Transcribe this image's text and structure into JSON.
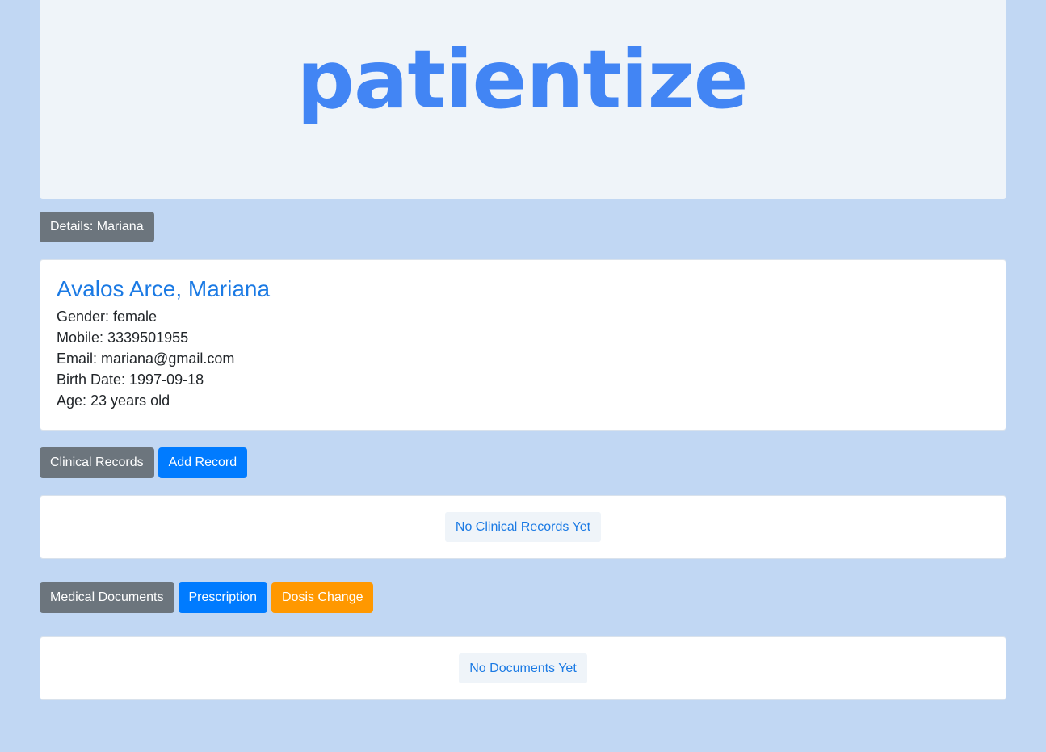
{
  "brand": {
    "logo_text": "patientize",
    "color": "#4285f4"
  },
  "details": {
    "label": "Details: Mariana"
  },
  "patient": {
    "name": "Avalos Arce, Mariana",
    "gender": "Gender: female",
    "mobile": "Mobile: 3339501955",
    "email": "Email: mariana@gmail.com",
    "birth_date": "Birth Date: 1997-09-18",
    "age": "Age: 23 years old"
  },
  "clinical": {
    "section_label": "Clinical Records",
    "add_label": "Add Record",
    "empty_text": "No Clinical Records Yet"
  },
  "documents": {
    "section_label": "Medical Documents",
    "prescription_label": "Prescription",
    "dosis_label": "Dosis Change",
    "empty_text": "No Documents Yet"
  },
  "colors": {
    "background": "#c1d7f3",
    "primary": "#007bff",
    "secondary": "#6c757d",
    "warning": "#ff9800",
    "accent_text": "#1b7ae4"
  }
}
